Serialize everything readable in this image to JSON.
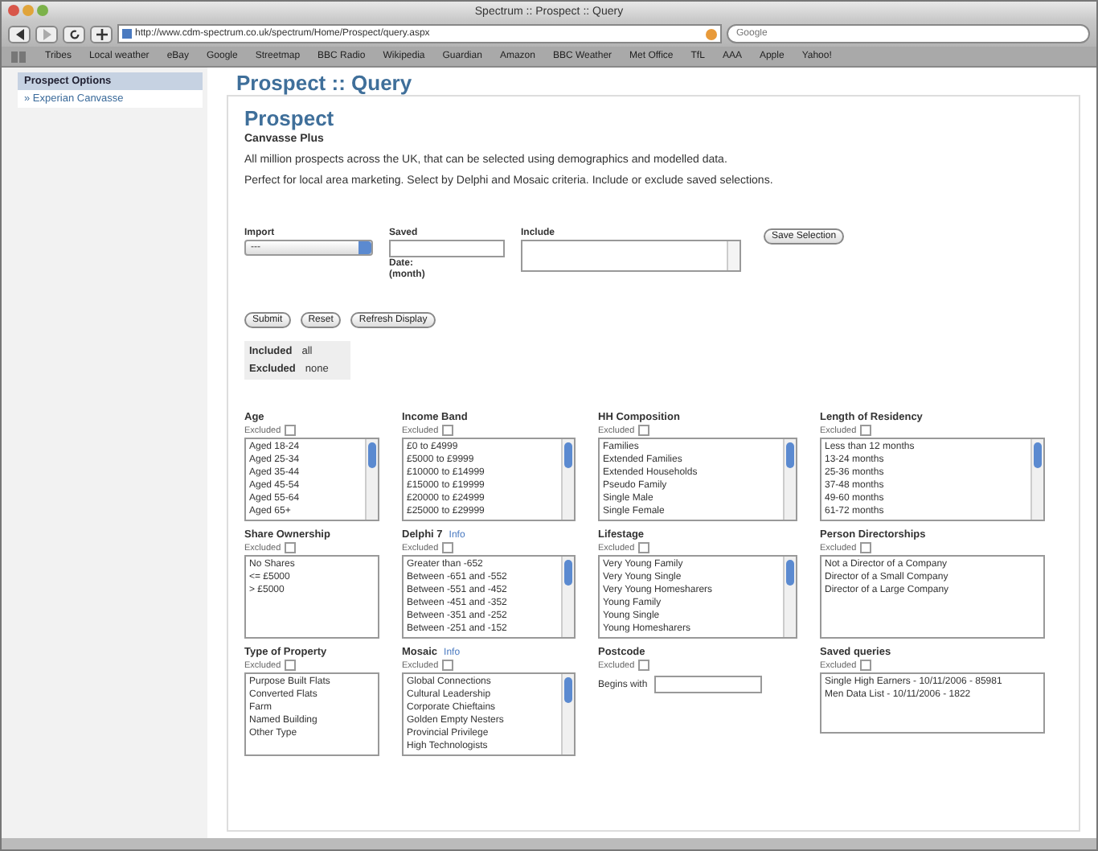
{
  "window": {
    "title": "Spectrum :: Prospect :: Query"
  },
  "toolbar": {
    "url": "http://www.cdm-spectrum.co.uk/spectrum/Home/Prospect/query.aspx",
    "search_placeholder": "Google"
  },
  "bookmarks": [
    "Tribes",
    "Local weather",
    "eBay",
    "Google",
    "Streetmap",
    "BBC Radio",
    "Wikipedia",
    "Guardian",
    "Amazon",
    "BBC Weather",
    "Met Office",
    "TfL",
    "AAA",
    "Apple",
    "Yahoo!"
  ],
  "sidebar": {
    "header": "Prospect Options",
    "items": [
      {
        "label": "» Experian Canvasse",
        "selected": false
      }
    ]
  },
  "page_title": "Prospect :: Query",
  "heading": "Prospect",
  "subheading": "Canvasse Plus",
  "paragraphs": [
    "All million prospects across the UK, that can be selected using demographics and modelled data.",
    "Perfect for local area marketing. Select by Delphi and Mosaic criteria. Include or exclude saved selections."
  ],
  "form": {
    "import": {
      "label": "Import",
      "value": "---"
    },
    "saved": {
      "label": "Saved",
      "note": "Date:",
      "note2": "(month)"
    },
    "include": {
      "label": "Include"
    },
    "save_button": "Save Selection"
  },
  "buttons": [
    "Submit",
    "Reset",
    "Refresh Display"
  ],
  "summary": [
    {
      "label": "Included",
      "value": "all"
    },
    {
      "label": "Excluded",
      "value": "none"
    }
  ],
  "filters": [
    {
      "kind": "list",
      "title": "Age",
      "excluded_label": "Excluded",
      "excluded": false,
      "options": [
        "Aged 18-24",
        "Aged 25-34",
        "Aged 35-44",
        "Aged 45-54",
        "Aged 55-64",
        "Aged 65+"
      ]
    },
    {
      "kind": "list",
      "title": "Income Band",
      "excluded_label": "Excluded",
      "excluded": false,
      "options": [
        "£0 to £4999",
        "£5000 to £9999",
        "£10000 to £14999",
        "£15000 to £19999",
        "£20000 to £24999",
        "£25000 to £29999"
      ]
    },
    {
      "kind": "list",
      "title": "HH Composition",
      "excluded_label": "Excluded",
      "excluded": false,
      "options": [
        "Families",
        "Extended Families",
        "Extended Households",
        "Pseudo Family",
        "Single Male",
        "Single Female"
      ]
    },
    {
      "kind": "list",
      "title": "Length of Residency",
      "excluded_label": "Excluded",
      "excluded": false,
      "options": [
        "Less than 12 months",
        "13-24 months",
        "25-36 months",
        "37-48 months",
        "49-60 months",
        "61-72 months"
      ]
    },
    {
      "kind": "list",
      "title": "Share Ownership",
      "excluded_label": "Excluded",
      "excluded": false,
      "options": [
        "No Shares",
        "<= £5000",
        "> £5000"
      ]
    },
    {
      "kind": "list",
      "title": "Delphi 7",
      "info": "Info",
      "excluded_label": "Excluded",
      "excluded": false,
      "options": [
        "Greater than -652",
        "Between -651 and -552",
        "Between -551 and -452",
        "Between -451 and -352",
        "Between -351 and -252",
        "Between -251 and -152"
      ]
    },
    {
      "kind": "list",
      "title": "Lifestage",
      "excluded_label": "Excluded",
      "excluded": false,
      "options": [
        "Very Young Family",
        "Very Young Single",
        "Very Young Homesharers",
        "Young Family",
        "Young Single",
        "Young Homesharers"
      ]
    },
    {
      "kind": "list",
      "title": "Person Directorships",
      "excluded_label": "Excluded",
      "excluded": false,
      "options": [
        "Not a Director of a Company",
        "Director of a Small Company",
        "Director of a Large Company"
      ]
    },
    {
      "kind": "list",
      "title": "Type of Property",
      "excluded_label": "Excluded",
      "excluded": false,
      "options": [
        "Purpose Built Flats",
        "Converted Flats",
        "Farm",
        "Named Building",
        "Other Type"
      ]
    },
    {
      "kind": "list",
      "title": "Mosaic",
      "info": "Info",
      "excluded_label": "Excluded",
      "excluded": false,
      "options": [
        "Global Connections",
        "Cultural Leadership",
        "Corporate Chieftains",
        "Golden Empty Nesters",
        "Provincial Privilege",
        "High Technologists"
      ]
    },
    {
      "kind": "text",
      "title": "Postcode",
      "excluded_label": "Excluded",
      "excluded": false,
      "input_label": "Begins with"
    },
    {
      "kind": "list",
      "title": "Saved queries",
      "excluded_label": "Excluded",
      "excluded": false,
      "options": [
        "Single High Earners - 10/11/2006 - 85981",
        "Men Data List - 10/11/2006 - 1822"
      ]
    }
  ]
}
